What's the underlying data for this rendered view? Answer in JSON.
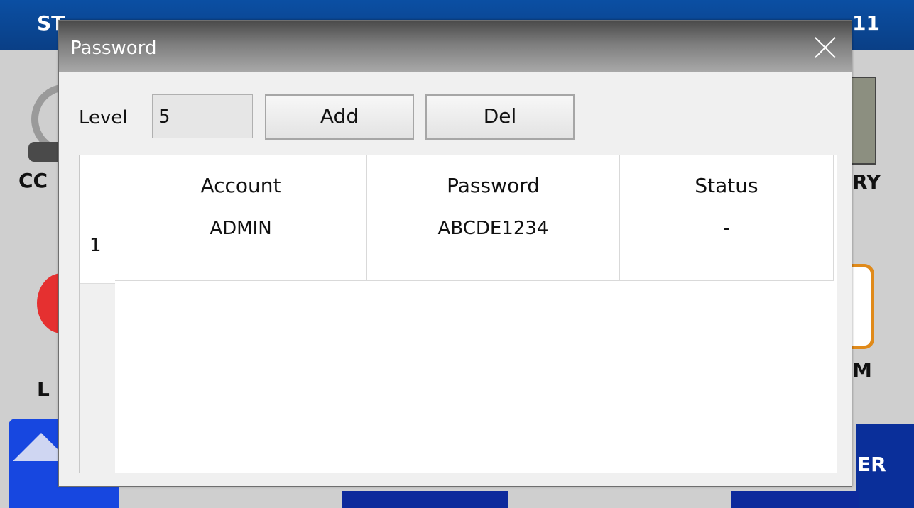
{
  "background": {
    "top_left_text": "ST",
    "top_right_text": "11",
    "label_left_1": "CC",
    "label_right_1": "RY",
    "label_left_2": "L",
    "label_right_2": "M",
    "bottom_right_btn": "ER"
  },
  "dialog": {
    "title": "Password",
    "level_label": "Level",
    "level_value": "5",
    "add_label": "Add",
    "del_label": "Del"
  },
  "table": {
    "headers": [
      "Account",
      "Password",
      "Status"
    ],
    "rows": [
      {
        "index": "1",
        "account": "ADMIN",
        "password": "ABCDE1234",
        "status": "-"
      }
    ]
  },
  "colors": {
    "topbar": "#0b4fa3",
    "dialog_bg": "#f0f0f0",
    "accent_blue": "#1747e0"
  }
}
